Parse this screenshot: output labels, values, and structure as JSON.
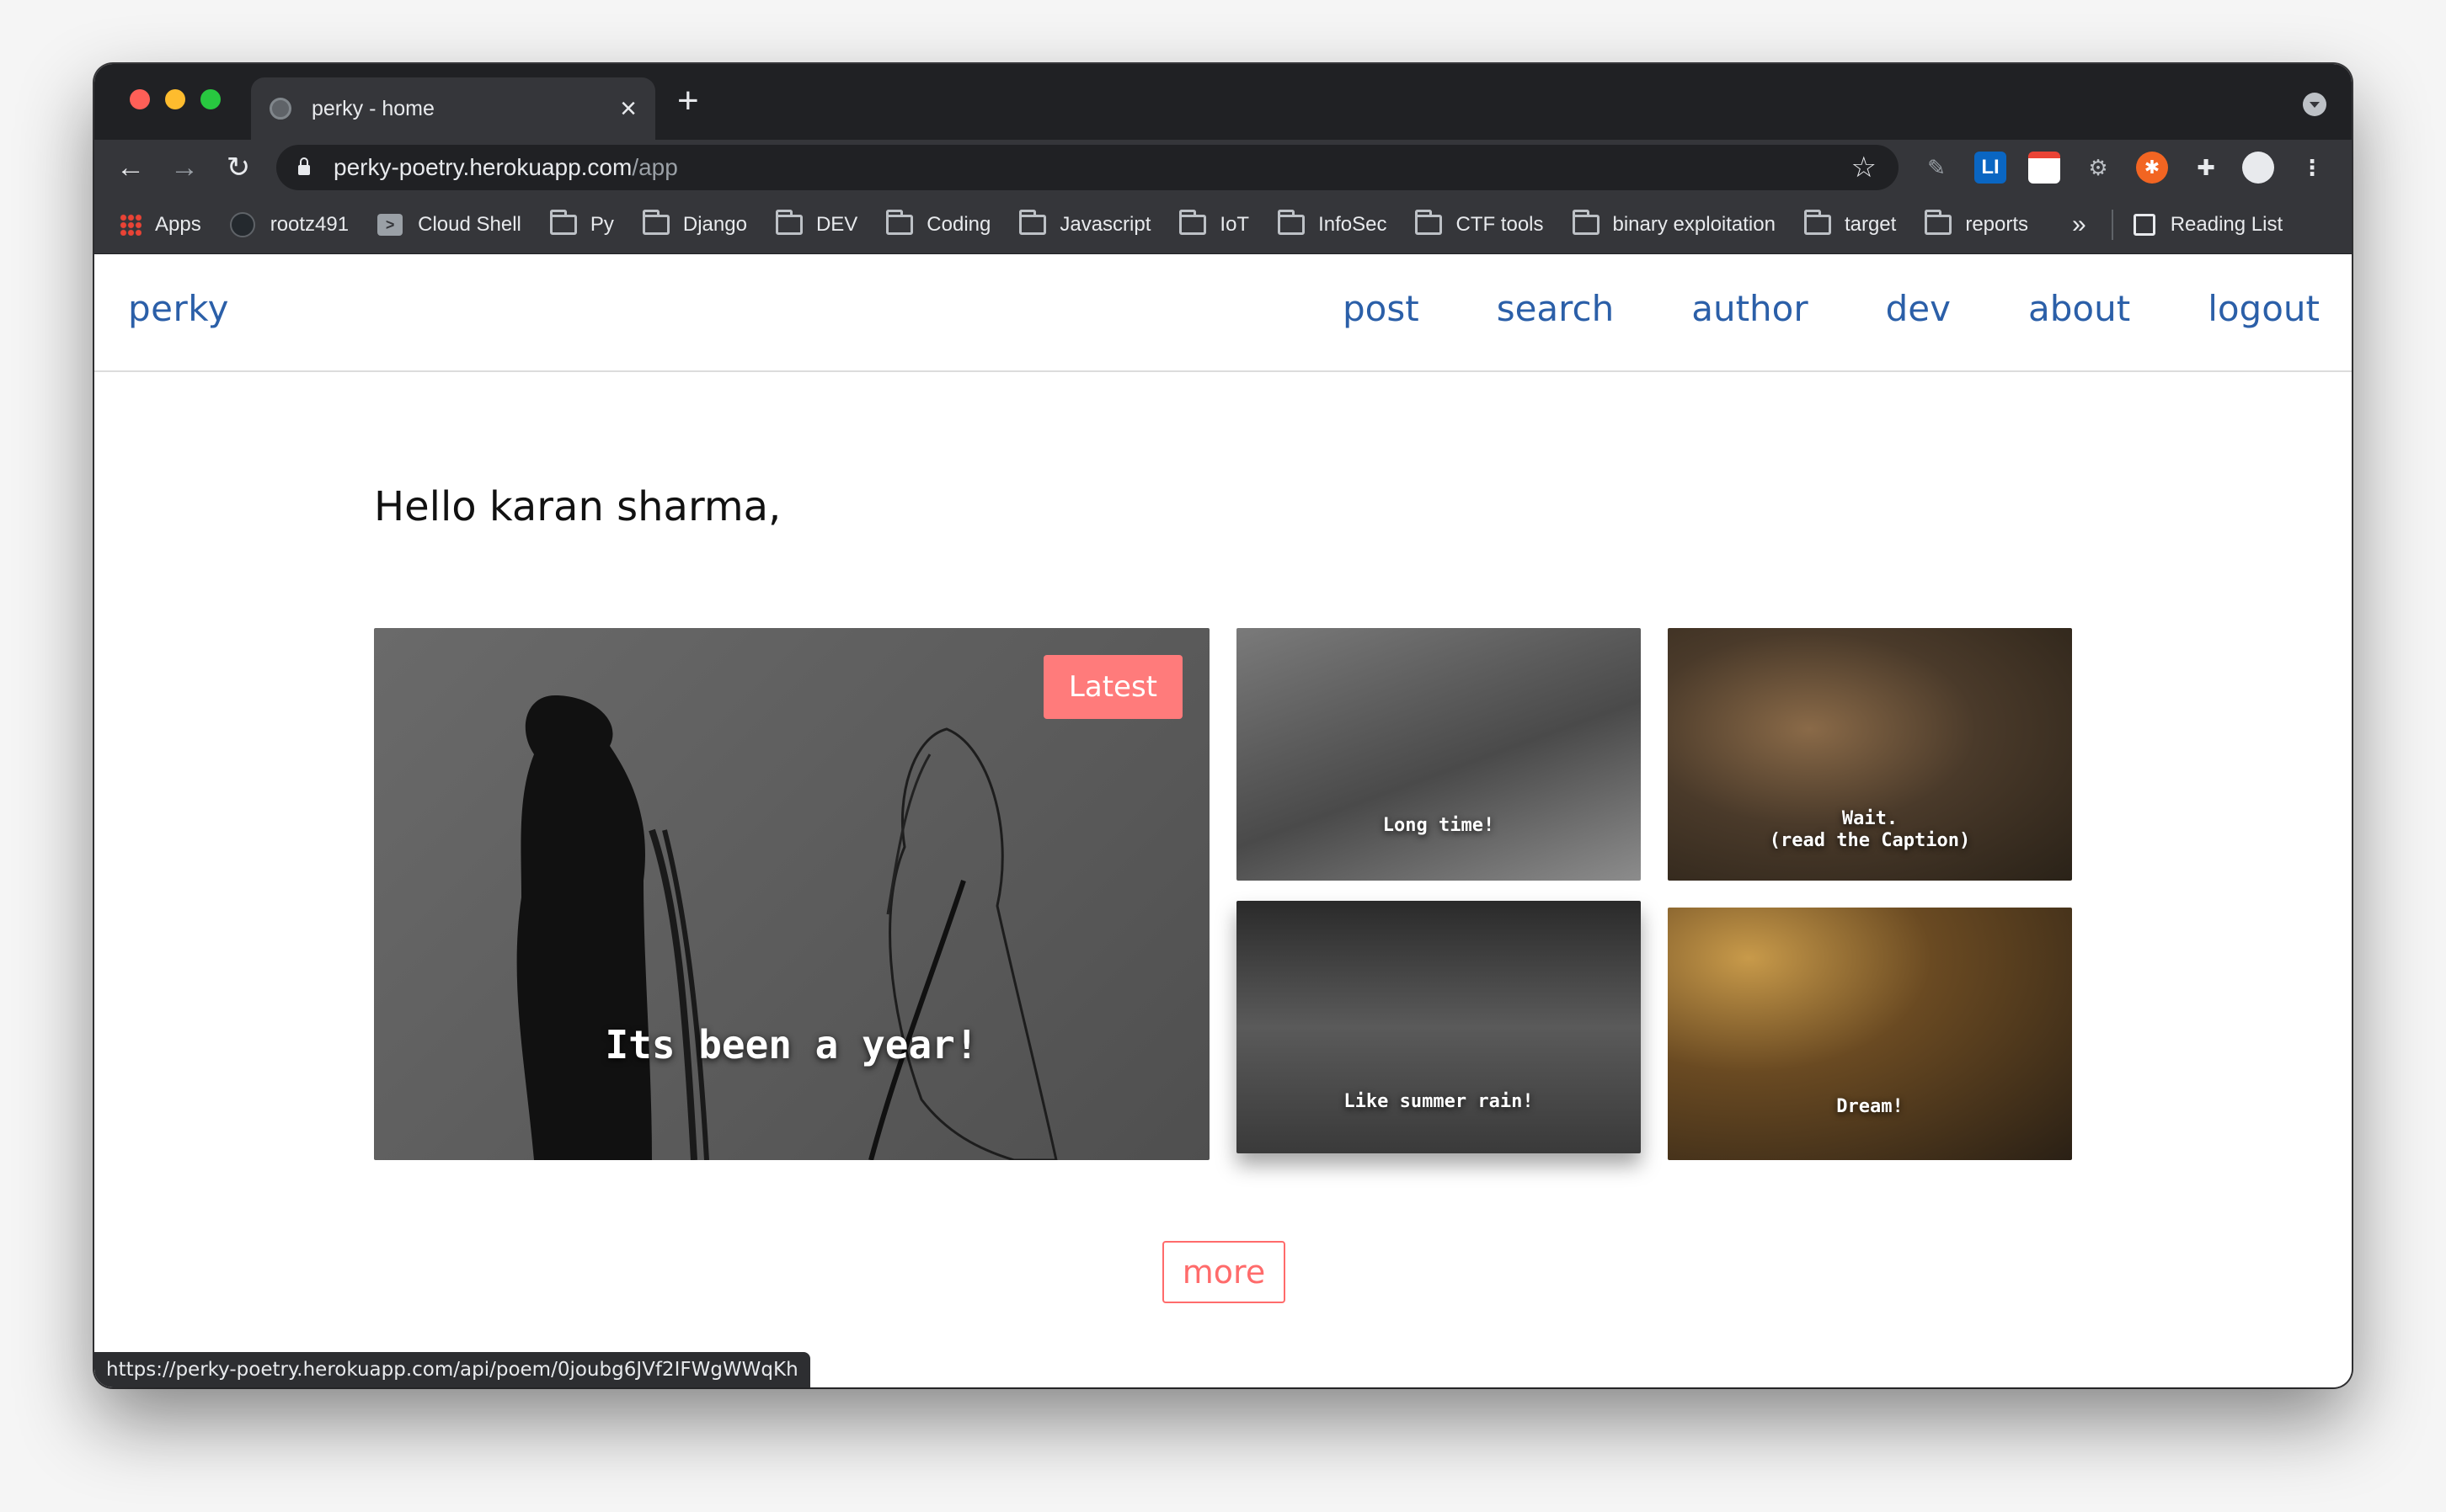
{
  "browser": {
    "tab_title": "perky - home",
    "url_host": "perky-poetry.herokuapp.com",
    "url_path": "/app",
    "status_url": "https://perky-poetry.herokuapp.com/api/poem/0joubg6JVf2IFWgWWqKh",
    "bookmarks": [
      {
        "label": "Apps",
        "icon": "apps-grid-icon"
      },
      {
        "label": "rootz491",
        "icon": "github-icon"
      },
      {
        "label": "Cloud Shell",
        "icon": "terminal-icon"
      },
      {
        "label": "Py",
        "icon": "folder-icon"
      },
      {
        "label": "Django",
        "icon": "folder-icon"
      },
      {
        "label": "DEV",
        "icon": "folder-icon"
      },
      {
        "label": "Coding",
        "icon": "folder-icon"
      },
      {
        "label": "Javascript",
        "icon": "folder-icon"
      },
      {
        "label": "IoT",
        "icon": "folder-icon"
      },
      {
        "label": "InfoSec",
        "icon": "folder-icon"
      },
      {
        "label": "CTF tools",
        "icon": "folder-icon"
      },
      {
        "label": "binary exploitation",
        "icon": "folder-icon"
      },
      {
        "label": "target",
        "icon": "folder-icon"
      },
      {
        "label": "reports",
        "icon": "folder-icon"
      }
    ],
    "overflow_label": "»",
    "reading_list_label": "Reading List",
    "ext_li_label": "LI"
  },
  "site": {
    "brand": "perky",
    "nav": [
      "post",
      "search",
      "author",
      "dev",
      "about",
      "logout"
    ],
    "greeting": "Hello karan sharma,",
    "latest_badge": "Latest",
    "more_label": "more",
    "poems": [
      {
        "caption": "Its been a year!"
      },
      {
        "caption": "Long time!"
      },
      {
        "caption": "Wait.\n(read the Caption)"
      },
      {
        "caption": "Like summer rain!"
      },
      {
        "caption": "Dream!"
      }
    ]
  },
  "colors": {
    "brand_blue": "#2b5fa8",
    "accent_coral": "#ff6b6b",
    "badge_bg": "#ff7b7b"
  }
}
